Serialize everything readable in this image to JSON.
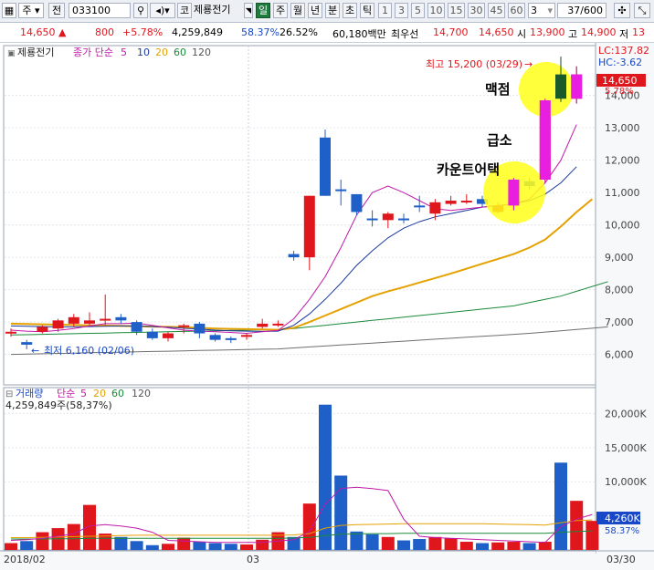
{
  "toolbar": {
    "market": "주",
    "jeon": "전",
    "code": "033100",
    "search_icon": "magnifier-icon",
    "sound_icon": "speaker-icon",
    "kospi_badge": "코",
    "stock_name": "제룡전기",
    "periods": [
      "일",
      "주",
      "월",
      "년",
      "분",
      "초",
      "틱"
    ],
    "selected_period": "일",
    "intervals": [
      "1",
      "3",
      "5",
      "10",
      "15",
      "30",
      "45",
      "60"
    ],
    "interval_value": "3",
    "page": "37/600"
  },
  "price_row": {
    "price": "14,650",
    "change": "800",
    "rate": "+5.78%",
    "volume": "4,259,849",
    "vol_ratio": "58.37%",
    "turnover": "26.52%",
    "amount": "60,180백만",
    "best_label": "최우선",
    "ask": "14,700",
    "bid": "14,650",
    "open_label": "시",
    "open": "13,900",
    "high_label": "고",
    "high": "14,900",
    "low_label": "저",
    "low": "13"
  },
  "price_chart": {
    "legend": {
      "name": "제룡전기",
      "ma": "종가 단순",
      "p5": "5",
      "p10": "10",
      "p20": "20",
      "p60": "60",
      "p120": "120"
    },
    "lc": "LC:137.82",
    "hc": "HC:-3.62",
    "current_price": "14,650",
    "current_rate": "5.78%",
    "high_note": "최고 15,200 (03/29)",
    "low_note": "최저 6,160 (02/06)",
    "ann_top": "맥점",
    "ann_mid": "급소",
    "ann_low": "카운트어택",
    "ylabels": [
      "14,000",
      "13,000",
      "12,000",
      "11,000",
      "10,000",
      "9,000",
      "8,000",
      "7,000",
      "6,000"
    ]
  },
  "volume_chart": {
    "legend": {
      "name": "거래량",
      "ma": "단순",
      "p5": "5",
      "p20": "20",
      "p60": "60",
      "p120": "120"
    },
    "current": "4,259,849주(58,37%)",
    "ylabels": [
      "20,000K",
      "15,000K",
      "10,000K",
      "5,000K"
    ],
    "cur_badge": "4,260K",
    "cur_rate": "58.37%"
  },
  "date_axis": {
    "start": "2018/02",
    "mid": "03",
    "end": "03/30"
  },
  "chart_data": {
    "type": "candlestick",
    "price_axis": {
      "ymin": 5200,
      "ymax": 15400,
      "ticks": [
        14000,
        13000,
        12000,
        11000,
        10000,
        9000,
        8000,
        7000,
        6000
      ]
    },
    "candles": [
      {
        "o": 6650,
        "c": 6700,
        "h": 6800,
        "l": 6550
      },
      {
        "o": 6380,
        "c": 6300,
        "h": 6450,
        "l": 6160
      },
      {
        "o": 6700,
        "c": 6850,
        "h": 6900,
        "l": 6650
      },
      {
        "o": 6800,
        "c": 7050,
        "h": 7100,
        "l": 6700
      },
      {
        "o": 6950,
        "c": 7150,
        "h": 7250,
        "l": 6850
      },
      {
        "o": 6950,
        "c": 7050,
        "h": 7300,
        "l": 6900
      },
      {
        "o": 7050,
        "c": 7100,
        "h": 7850,
        "l": 6900
      },
      {
        "o": 7150,
        "c": 7050,
        "h": 7250,
        "l": 6950
      },
      {
        "o": 7000,
        "c": 6700,
        "h": 7050,
        "l": 6600
      },
      {
        "o": 6700,
        "c": 6500,
        "h": 6800,
        "l": 6450
      },
      {
        "o": 6500,
        "c": 6650,
        "h": 6700,
        "l": 6400
      },
      {
        "o": 6850,
        "c": 6900,
        "h": 6950,
        "l": 6650
      },
      {
        "o": 6950,
        "c": 6650,
        "h": 7000,
        "l": 6500
      },
      {
        "o": 6600,
        "c": 6450,
        "h": 6650,
        "l": 6400
      },
      {
        "o": 6500,
        "c": 6450,
        "h": 6550,
        "l": 6350
      },
      {
        "o": 6550,
        "c": 6600,
        "h": 6650,
        "l": 6450
      },
      {
        "o": 6850,
        "c": 6950,
        "h": 7100,
        "l": 6800
      },
      {
        "o": 6900,
        "c": 6950,
        "h": 7050,
        "l": 6850
      },
      {
        "o": 9100,
        "c": 9000,
        "h": 9200,
        "l": 8900
      },
      {
        "o": 9000,
        "c": 10900,
        "h": 10900,
        "l": 8600
      },
      {
        "o": 12700,
        "c": 10900,
        "h": 12950,
        "l": 10900
      },
      {
        "o": 11100,
        "c": 11050,
        "h": 11400,
        "l": 10600
      },
      {
        "o": 10950,
        "c": 10400,
        "h": 10950,
        "l": 10300
      },
      {
        "o": 10200,
        "c": 10150,
        "h": 10450,
        "l": 9950
      },
      {
        "o": 10150,
        "c": 10350,
        "h": 10400,
        "l": 9900
      },
      {
        "o": 10200,
        "c": 10150,
        "h": 10350,
        "l": 10050
      },
      {
        "o": 10600,
        "c": 10550,
        "h": 10900,
        "l": 10400
      },
      {
        "o": 10350,
        "c": 10700,
        "h": 10800,
        "l": 10150
      },
      {
        "o": 10650,
        "c": 10750,
        "h": 10900,
        "l": 10600
      },
      {
        "o": 10700,
        "c": 10750,
        "h": 10950,
        "l": 10650
      },
      {
        "o": 10800,
        "c": 10650,
        "h": 10900,
        "l": 10550
      },
      {
        "o": 10400,
        "c": 10600,
        "h": 10700,
        "l": 10350
      },
      {
        "o": 10600,
        "c": 11400,
        "h": 11450,
        "l": 10450
      },
      {
        "o": 11350,
        "c": 11200,
        "h": 11450,
        "l": 11100
      },
      {
        "o": 11400,
        "c": 13850,
        "h": 13900,
        "l": 11300
      },
      {
        "o": 14650,
        "c": 13900,
        "h": 15200,
        "l": 13800
      },
      {
        "o": 13900,
        "c": 14650,
        "h": 14900,
        "l": 13750
      }
    ],
    "ma5": [
      6750,
      6720,
      6700,
      6740,
      6800,
      6880,
      6950,
      6950,
      6970,
      6900,
      6820,
      6750,
      6720,
      6700,
      6680,
      6650,
      6700,
      6740,
      7100,
      7700,
      8400,
      9300,
      10300,
      11000,
      11200,
      11000,
      10750,
      10500,
      10450,
      10500,
      10550,
      10600,
      10650,
      10800,
      11300,
      12000,
      13100
    ],
    "ma10": [
      6880,
      6870,
      6860,
      6850,
      6850,
      6860,
      6870,
      6880,
      6880,
      6860,
      6840,
      6810,
      6780,
      6750,
      6730,
      6720,
      6710,
      6720,
      6900,
      7250,
      7700,
      8200,
      8750,
      9200,
      9600,
      9900,
      10100,
      10250,
      10350,
      10450,
      10550,
      10600,
      10650,
      10750,
      10950,
      11300,
      11800
    ],
    "ma20": [
      6950,
      6940,
      6930,
      6920,
      6910,
      6900,
      6890,
      6880,
      6870,
      6860,
      6850,
      6840,
      6820,
      6800,
      6790,
      6780,
      6770,
      6760,
      6820,
      7000,
      7200,
      7400,
      7600,
      7800,
      7950,
      8080,
      8220,
      8360,
      8500,
      8650,
      8800,
      8950,
      9100,
      9300,
      9550,
      9950,
      10400,
      10800
    ],
    "ma60": [
      6600,
      6610,
      6620,
      6630,
      6640,
      6650,
      6660,
      6670,
      6680,
      6690,
      6700,
      6710,
      6720,
      6730,
      6740,
      6750,
      6760,
      6770,
      6800,
      6850,
      6900,
      6950,
      7000,
      7050,
      7100,
      7150,
      7200,
      7250,
      7300,
      7350,
      7400,
      7450,
      7500,
      7600,
      7700,
      7800,
      7950,
      8100,
      8250
    ],
    "ma120": [
      6000,
      6010,
      6020,
      6030,
      6040,
      6050,
      6060,
      6070,
      6080,
      6090,
      6100,
      6110,
      6120,
      6130,
      6140,
      6150,
      6160,
      6170,
      6200,
      6230,
      6260,
      6290,
      6320,
      6350,
      6380,
      6410,
      6440,
      6470,
      6500,
      6530,
      6560,
      6590,
      6620,
      6650,
      6690,
      6730,
      6770,
      6810,
      6850
    ],
    "volume_axis": {
      "ymin": 0,
      "ymax": 23000,
      "ticks": [
        20000,
        15000,
        10000,
        5000
      ],
      "unit": "K"
    },
    "volume": [
      1000,
      1300,
      2600,
      3200,
      3800,
      6600,
      2400,
      1900,
      1300,
      700,
      900,
      1800,
      1200,
      1000,
      900,
      800,
      1500,
      2600,
      1900,
      6800,
      21300,
      10900,
      2700,
      2300,
      1900,
      1400,
      1600,
      1900,
      1700,
      1200,
      1000,
      1100,
      1200,
      1000,
      1200,
      12800,
      7200,
      4260
    ],
    "vol_ma5": [
      1400,
      1500,
      1700,
      2000,
      2400,
      3500,
      3700,
      3500,
      3200,
      2600,
      1400,
      1300,
      1200,
      1100,
      1100,
      1100,
      1100,
      1300,
      1500,
      2700,
      6700,
      9000,
      9200,
      9000,
      8700,
      4500,
      2000,
      1800,
      1700,
      1600,
      1500,
      1400,
      1300,
      1200,
      1100,
      3400,
      4500,
      5200
    ],
    "vol_ma20": [
      1800,
      1800,
      1850,
      1900,
      1950,
      2000,
      2050,
      2100,
      2150,
      2150,
      2150,
      2150,
      2150,
      2150,
      2150,
      2150,
      2150,
      2150,
      2200,
      2400,
      3200,
      3600,
      3700,
      3750,
      3800,
      3850,
      3850,
      3850,
      3850,
      3850,
      3850,
      3800,
      3750,
      3700,
      3650,
      4000,
      4300,
      4400
    ],
    "vol_ma60": [
      1600,
      1600,
      1600,
      1650,
      1650,
      1700,
      1700,
      1700,
      1700,
      1700,
      1700,
      1700,
      1700,
      1700,
      1700,
      1700,
      1700,
      1700,
      1750,
      1850,
      2100,
      2300,
      2350,
      2400,
      2400,
      2450,
      2450,
      2450,
      2450,
      2450,
      2450,
      2450,
      2450,
      2450,
      2450,
      2600,
      2700,
      2800
    ]
  }
}
